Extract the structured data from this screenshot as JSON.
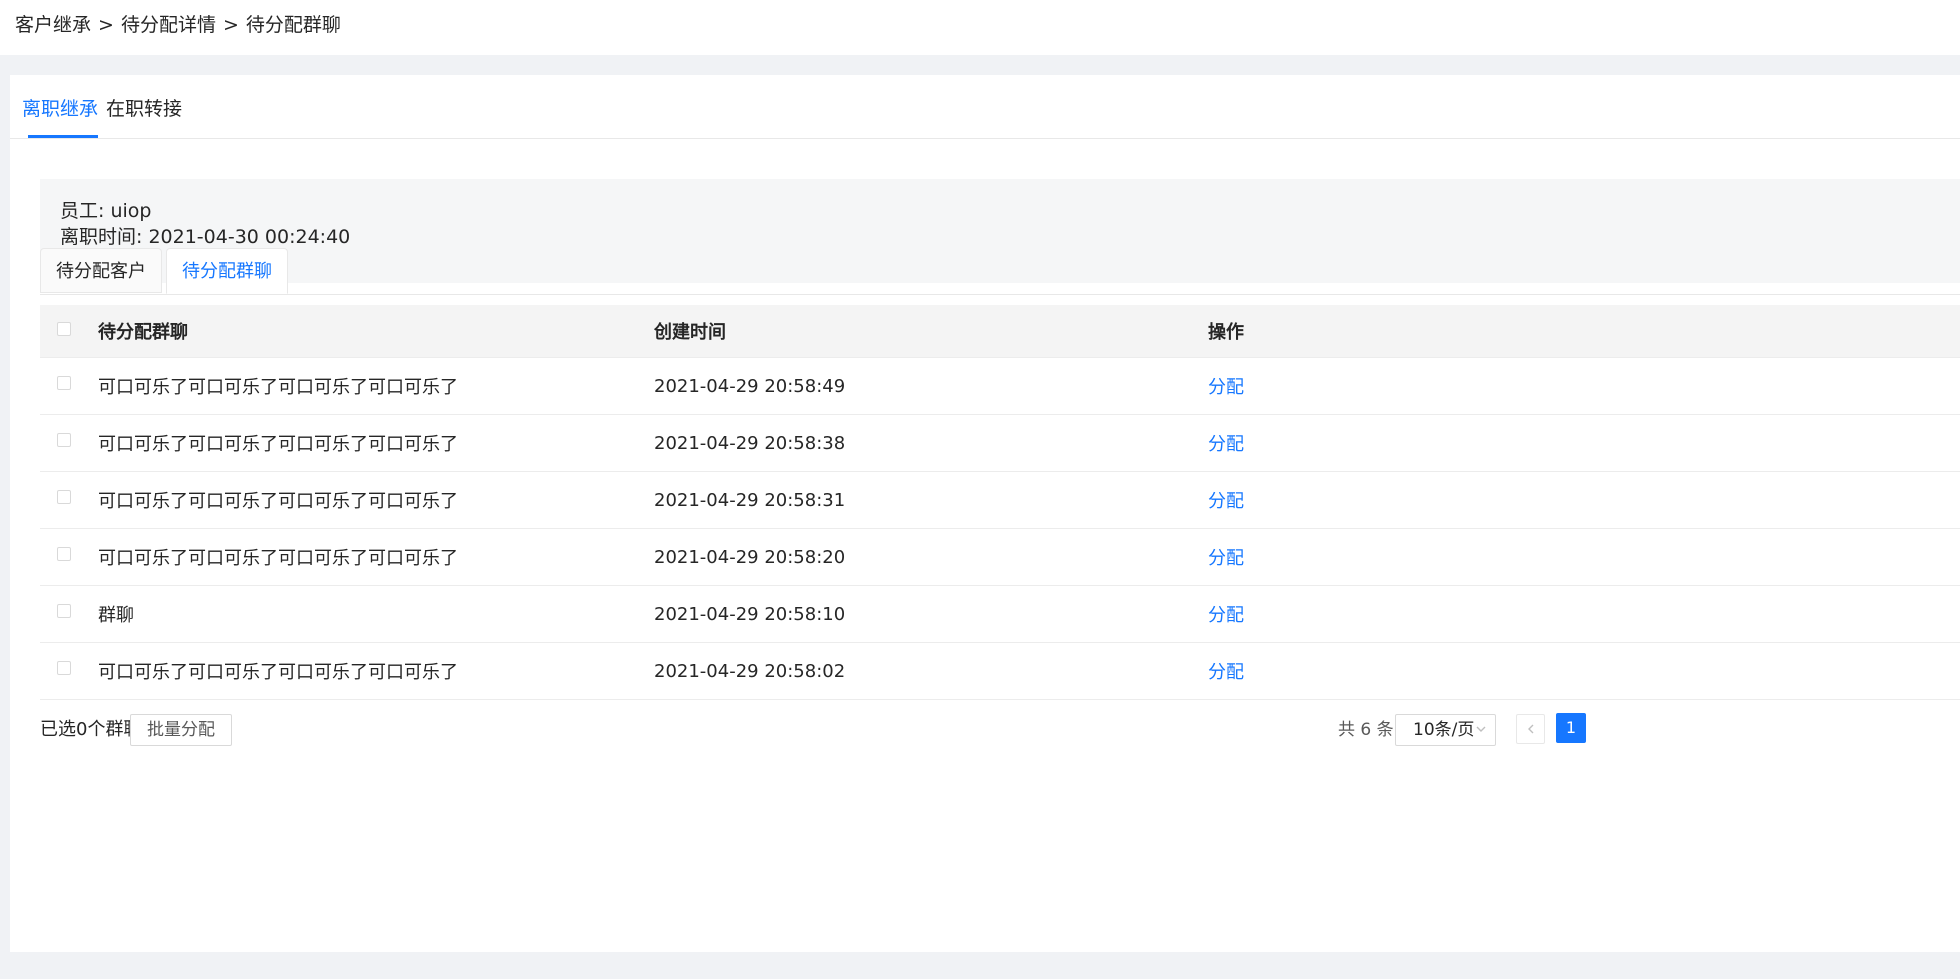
{
  "breadcrumb": {
    "items": [
      "客户继承",
      "待分配详情",
      "待分配群聊"
    ],
    "separator": ">"
  },
  "top_tabs": [
    {
      "label": "离职继承",
      "active": true
    },
    {
      "label": "在职转接",
      "active": false
    }
  ],
  "info": {
    "employee_label": "员工:",
    "employee_value": "uiop",
    "resign_label": "离职时间:",
    "resign_value": "2021-04-30 00:24:40"
  },
  "card_tabs": [
    {
      "label": "待分配客户",
      "active": false
    },
    {
      "label": "待分配群聊",
      "active": true
    }
  ],
  "table": {
    "headers": {
      "name": "待分配群聊",
      "created": "创建时间",
      "action": "操作"
    },
    "rows": [
      {
        "name": "可口可乐了可口可乐了可口可乐了可口可乐了",
        "created": "2021-04-29 20:58:49",
        "action": "分配"
      },
      {
        "name": "可口可乐了可口可乐了可口可乐了可口可乐了",
        "created": "2021-04-29 20:58:38",
        "action": "分配"
      },
      {
        "name": "可口可乐了可口可乐了可口可乐了可口可乐了",
        "created": "2021-04-29 20:58:31",
        "action": "分配"
      },
      {
        "name": "可口可乐了可口可乐了可口可乐了可口可乐了",
        "created": "2021-04-29 20:58:20",
        "action": "分配"
      },
      {
        "name": "群聊",
        "created": "2021-04-29 20:58:10",
        "action": "分配"
      },
      {
        "name": "可口可乐了可口可乐了可口可乐了可口可乐了",
        "created": "2021-04-29 20:58:02",
        "action": "分配"
      }
    ]
  },
  "footer": {
    "selected_text": "已选0个群聊",
    "batch_button": "批量分配",
    "total_text": "共 6 条",
    "page_size": "10条/页",
    "current_page": "1"
  },
  "colors": {
    "accent": "#1677ff",
    "page_bg": "#f0f2f5",
    "info_bg": "#f5f6f7",
    "table_header_bg": "#f4f4f4"
  },
  "icons": {
    "page_size_dropdown": "chevron-down-icon",
    "prev_page": "chevron-left-icon"
  }
}
